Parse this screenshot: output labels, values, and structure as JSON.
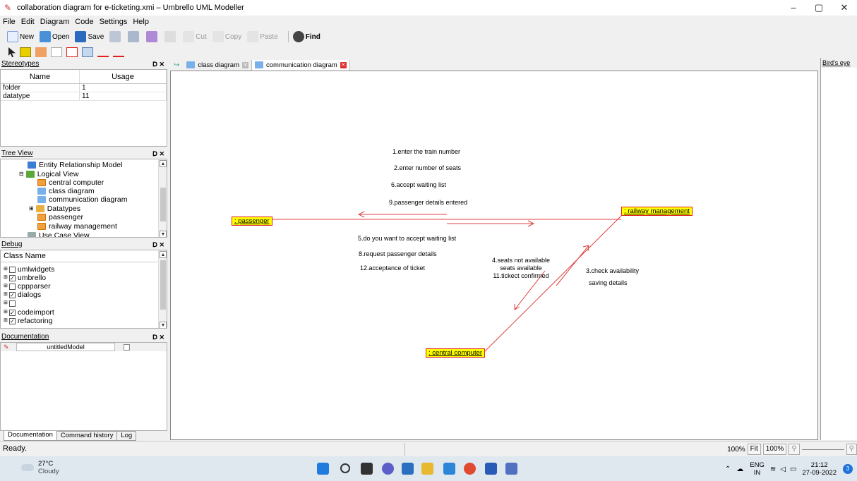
{
  "window": {
    "title": "collaboration diagram for e-ticketing.xmi – Umbrello UML Modeller",
    "controls": [
      "–",
      "▢",
      "✕"
    ]
  },
  "menu": [
    "File",
    "Edit",
    "Diagram",
    "Code",
    "Settings",
    "Help"
  ],
  "toolbar": {
    "new": "New",
    "open": "Open",
    "save": "Save",
    "cut": "Cut",
    "copy": "Copy",
    "paste": "Paste",
    "find": "Find"
  },
  "stereotypes": {
    "title": "Stereotypes",
    "columns": [
      "Name",
      "Usage"
    ],
    "rows": [
      {
        "name": "folder",
        "usage": "1"
      },
      {
        "name": "datatype",
        "usage": "11"
      }
    ]
  },
  "tree_view": {
    "title": "Tree View",
    "items": [
      "Entity Relationship Model",
      "Logical View",
      "central computer",
      "class diagram",
      "communication diagram",
      "Datatypes",
      "passenger",
      "railway management",
      "Use Case View"
    ]
  },
  "debug": {
    "title": "Debug",
    "column": "Class Name",
    "items": [
      {
        "label": "umlwidgets",
        "checked": false
      },
      {
        "label": "umbrello",
        "checked": true
      },
      {
        "label": "cppparser",
        "checked": false
      },
      {
        "label": "dialogs",
        "checked": true
      },
      {
        "label": "",
        "checked": false
      },
      {
        "label": "codeimport",
        "checked": true
      },
      {
        "label": "refactoring",
        "checked": true
      }
    ]
  },
  "documentation": {
    "title": "Documentation",
    "model": "untitledModel",
    "tabs": [
      "Documentation",
      "Command history",
      "Log"
    ]
  },
  "diagram_tabs": [
    "class diagram",
    "communication diagram"
  ],
  "diagram": {
    "objects": {
      "passenger": ": passenger",
      "railway": ": railway management",
      "central": ": central computer"
    },
    "messages_top": [
      "1.enter the train number",
      "2.enter number of seats",
      "6.accept waiting list",
      "9.passenger details entered"
    ],
    "messages_bottom": [
      "5.do you want to accept waiting list",
      "8.request passenger details",
      "12.acceptance of ticket"
    ],
    "messages_central_to_railway": [
      "4.seats not available",
      "seats available",
      "11.tickect confirmed"
    ],
    "messages_railway_to_central": [
      "3.check availability",
      "saving details"
    ]
  },
  "birds_eye": {
    "title": "Bird's eye"
  },
  "status": {
    "text": "Ready.",
    "zoom": "100%",
    "fit": "Fit",
    "zoom_box": "100%"
  },
  "taskbar": {
    "temp": "27°C",
    "weather": "Cloudy",
    "lang1": "ENG",
    "lang2": "IN",
    "time": "21:12",
    "date": "27-09-2022",
    "notifications": "3"
  }
}
